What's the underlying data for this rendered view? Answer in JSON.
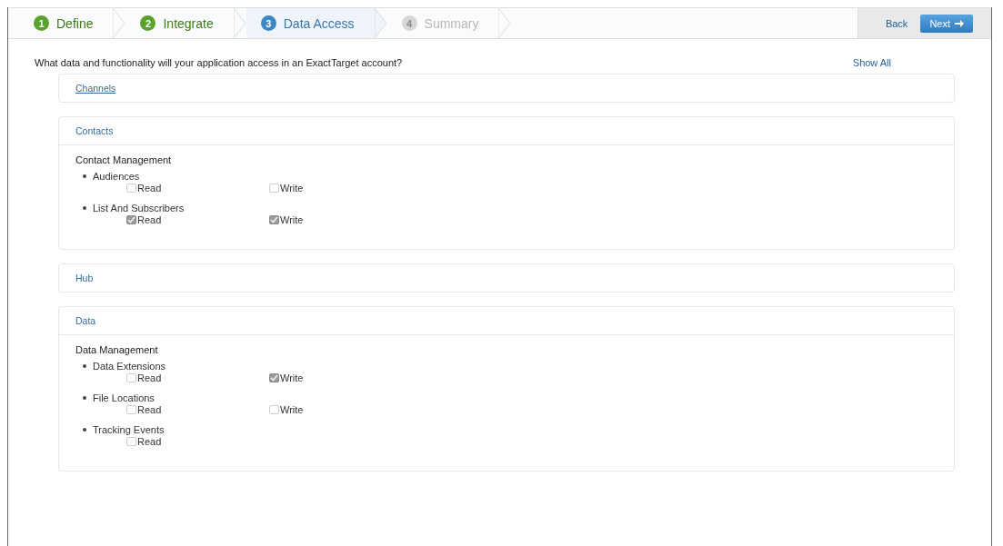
{
  "steps": [
    {
      "number": "1",
      "label": "Define",
      "kind": "done",
      "selected": false
    },
    {
      "number": "2",
      "label": "Integrate",
      "kind": "done",
      "selected": false
    },
    {
      "number": "3",
      "label": "Data Access",
      "kind": "current",
      "selected": true
    },
    {
      "number": "4",
      "label": "Summary",
      "kind": "upcoming",
      "selected": false
    }
  ],
  "nav_buttons": [
    {
      "label": "Back",
      "kind": "plain"
    },
    {
      "label": "Next",
      "kind": "primary"
    }
  ],
  "question": "What data and functionality will your application access in an ExactTarget account?",
  "show_all": "Show All",
  "sections": [
    {
      "title": "Channels",
      "expanded": false,
      "hovered": true
    },
    {
      "title": "Contacts",
      "expanded": true,
      "hovered": false,
      "groups": [
        {
          "title": "Contact Management",
          "items": [
            {
              "name": "Audiences",
              "permissions": [
                {
                  "label": "Read",
                  "checked": false
                },
                {
                  "label": "Write",
                  "checked": false
                }
              ]
            },
            {
              "name": "List And Subscribers",
              "permissions": [
                {
                  "label": "Read",
                  "checked": true
                },
                {
                  "label": "Write",
                  "checked": true
                }
              ]
            }
          ]
        }
      ]
    },
    {
      "title": "Hub",
      "expanded": false,
      "hovered": false
    },
    {
      "title": "Data",
      "expanded": true,
      "hovered": false,
      "groups": [
        {
          "title": "Data Management",
          "items": [
            {
              "name": "Data Extensions",
              "permissions": [
                {
                  "label": "Read",
                  "checked": false
                },
                {
                  "label": "Write",
                  "checked": true
                }
              ]
            },
            {
              "name": "File Locations",
              "permissions": [
                {
                  "label": "Read",
                  "checked": false
                },
                {
                  "label": "Write",
                  "checked": false
                }
              ]
            },
            {
              "name": "Tracking Events",
              "permissions": [
                {
                  "label": "Read",
                  "checked": false
                }
              ]
            }
          ]
        }
      ]
    }
  ]
}
